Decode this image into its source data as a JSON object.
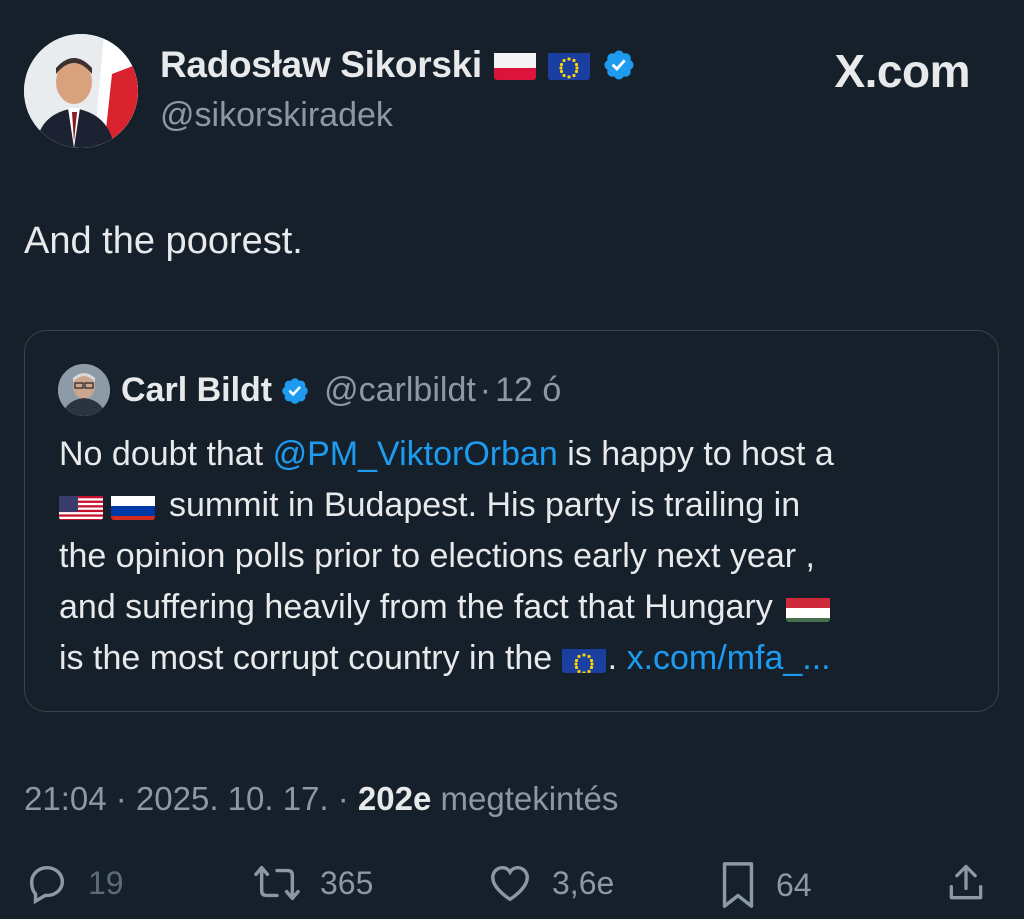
{
  "author": {
    "name": "Radosław Sikorski",
    "handle": "@sikorskiradek",
    "flags": [
      "poland-flag",
      "eu-flag"
    ],
    "verified": true
  },
  "brand": {
    "label": "X.com"
  },
  "tweet": {
    "text": "And the poorest."
  },
  "quoted": {
    "name": "Carl Bildt",
    "handle": "@carlbildt",
    "separator": "·",
    "time": "12 ó",
    "lines": {
      "l1_pre": "No doubt that ",
      "l1_mention": "@PM_ViktorOrban",
      "l1_post": " is happy to host a",
      "l2": "summit in Budapest. His party is trailing in",
      "l3": "the opinion polls prior to elections early next year ,",
      "l4": "and suffering heavily from the fact that Hungary",
      "l5_pre": "is the most corrupt country in the",
      "l5_dot": ". ",
      "l5_link": "x.com/mfa_..."
    }
  },
  "meta": {
    "time": "21:04",
    "sep1": " · ",
    "date": "2025. 10. 17.",
    "sep2": " · ",
    "views_count": "202e",
    "views_label": " megtekintés"
  },
  "actions": {
    "replies": "19",
    "reposts": "365",
    "likes": "3,6e",
    "bookmarks": "64"
  },
  "colors": {
    "background": "#15202b",
    "accent": "#1d9bf0",
    "muted": "#8b98a5"
  }
}
